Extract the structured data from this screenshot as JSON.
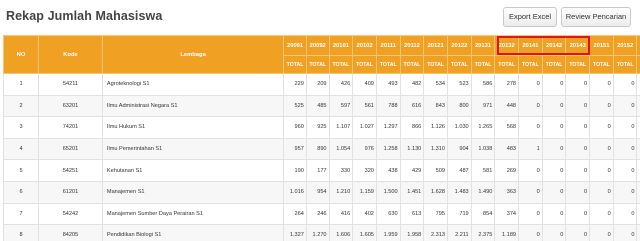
{
  "page": {
    "title": "Rekap Jumlah Mahasiswa"
  },
  "toolbar": {
    "export_label": "Export Excel",
    "review_label": "Review Pencarian"
  },
  "table": {
    "headers": {
      "no": "NO",
      "kode": "Kode",
      "lembaga": "Lembaga"
    },
    "periods": [
      "20091",
      "20092",
      "20101",
      "20102",
      "20111",
      "20112",
      "20121",
      "20122",
      "20131",
      "20132",
      "20141",
      "20142",
      "20143",
      "20151",
      "20152",
      "20161"
    ],
    "sub_header": "TOTAL",
    "rows": [
      {
        "no": "1",
        "kode": "54211",
        "lembaga": "Agroteknologi S1",
        "values": [
          "229",
          "209",
          "426",
          "409",
          "493",
          "482",
          "534",
          "523",
          "586",
          "278",
          "0",
          "0",
          "0",
          "0",
          "0",
          "0"
        ]
      },
      {
        "no": "2",
        "kode": "63201",
        "lembaga": "Ilmu Administrasi Negara S1",
        "values": [
          "525",
          "485",
          "597",
          "561",
          "788",
          "616",
          "843",
          "800",
          "971",
          "448",
          "0",
          "0",
          "0",
          "0",
          "0",
          "0"
        ]
      },
      {
        "no": "3",
        "kode": "74201",
        "lembaga": "Ilmu Hukum S1",
        "values": [
          "960",
          "925",
          "1.107",
          "1.027",
          "1.297",
          "866",
          "1.126",
          "1.030",
          "1.265",
          "568",
          "0",
          "0",
          "0",
          "0",
          "0",
          "0"
        ]
      },
      {
        "no": "4",
        "kode": "65201",
        "lembaga": "Ilmu Pemerintahan S1",
        "values": [
          "957",
          "890",
          "1.054",
          "976",
          "1.258",
          "1.130",
          "1.310",
          "904",
          "1.038",
          "483",
          "1",
          "0",
          "0",
          "0",
          "0",
          "0"
        ]
      },
      {
        "no": "5",
        "kode": "54251",
        "lembaga": "Kehutanan S1",
        "values": [
          "190",
          "177",
          "330",
          "320",
          "438",
          "429",
          "509",
          "487",
          "581",
          "269",
          "0",
          "0",
          "0",
          "0",
          "0",
          "0"
        ]
      },
      {
        "no": "6",
        "kode": "61201",
        "lembaga": "Manajemen S1",
        "values": [
          "1.016",
          "954",
          "1.210",
          "1.159",
          "1.500",
          "1.451",
          "1.628",
          "1.483",
          "1.490",
          "363",
          "0",
          "0",
          "0",
          "0",
          "0",
          "0"
        ]
      },
      {
        "no": "7",
        "kode": "54242",
        "lembaga": "Manajemen Sumber Daya Perairan S1",
        "values": [
          "264",
          "246",
          "416",
          "402",
          "630",
          "613",
          "795",
          "719",
          "854",
          "374",
          "0",
          "0",
          "0",
          "0",
          "0",
          "0"
        ]
      },
      {
        "no": "8",
        "kode": "84205",
        "lembaga": "Pendidikan Biologi S1",
        "values": [
          "1.327",
          "1.270",
          "1.606",
          "1.605",
          "1.959",
          "1.958",
          "2.313",
          "2.211",
          "2.375",
          "1.189",
          "0",
          "0",
          "0",
          "0",
          "0",
          "0"
        ]
      }
    ]
  },
  "highlight": {
    "color": "#e0131b",
    "periods": [
      "20141",
      "20142",
      "20143",
      "20151"
    ]
  },
  "colors": {
    "header_bg": "#f0a023",
    "header_text": "#ffffff"
  }
}
